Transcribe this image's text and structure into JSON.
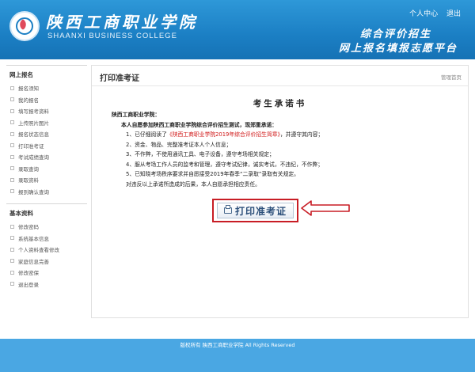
{
  "header": {
    "college_cn": "陕西工商职业学院",
    "college_en": "SHAANXI BUSINESS COLLEGE",
    "links": [
      "个人中心",
      "退出"
    ],
    "slogan_line1": "综合评价招生",
    "slogan_line2": "网上报名填报志愿平台"
  },
  "sidebar": {
    "sections": [
      {
        "title": "网上报名",
        "items": [
          "报名须知",
          "我的报名",
          "填写报考资料",
          "上传照片图片",
          "报名状态信息",
          "打印准考证",
          "考试成绩查询",
          "录取查询",
          "录取资料",
          "报到确认查询"
        ]
      },
      {
        "title": "基本资料",
        "items": [
          "修改密码",
          "系统基本信息",
          "个人资料查看修改",
          "家庭信息完善",
          "修改密保",
          "退出登录"
        ]
      }
    ]
  },
  "main": {
    "page_title": "打印准考证",
    "home_link": "管理首页",
    "pledge_title": "考生承诺书",
    "pledge_to": "陕西工商职业学院：",
    "pledge_intro": "本人自愿参加陕西工商职业学院综合评价招生测试，现郑重承诺：",
    "pledge_items": [
      {
        "num": "1、",
        "pre": "已仔细阅读了",
        "hl": "《陕西工商职业学院2019年综合评价招生简章》",
        "post": "，并遵守其内容；"
      },
      {
        "num": "2、",
        "pre": "资金、物品、完整准考证本人个人信息；",
        "hl": "",
        "post": ""
      },
      {
        "num": "3、",
        "pre": "不作弊，不使用通讯工具、电子设备，遵守考场相关规定；",
        "hl": "",
        "post": ""
      },
      {
        "num": "4、",
        "pre": "服从考场工作人员的监考和管理，遵守考试纪律，诚实考试，不违纪，不作弊；",
        "hl": "",
        "post": ""
      },
      {
        "num": "5、",
        "pre": "已知晓考场秩序要求并自愿接受2019年春季“二录取”录取有关规定。",
        "hl": "",
        "post": ""
      }
    ],
    "pledge_closing": "对违反以上承诺所造成的后果，本人自愿承担相应责任。",
    "print_button": "打印准考证"
  },
  "footer": {
    "text": "版权所有 陕西工商职业学院 All Rights Reserved"
  },
  "colors": {
    "header": "#1b7fc4",
    "footer": "#4aa7e3",
    "highlight_box": "#c81d25"
  }
}
